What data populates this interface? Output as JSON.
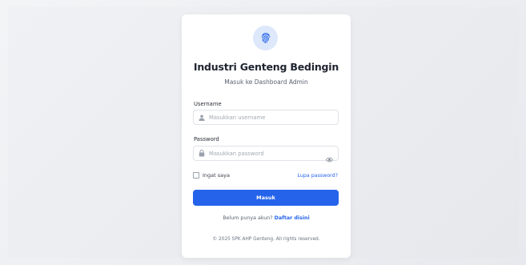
{
  "app": {
    "title": "Industri Genteng Bedingin",
    "subtitle": "Masuk ke Dashboard Admin"
  },
  "form": {
    "username_label": "Username",
    "username_placeholder": "Masukkan username",
    "username_value": "",
    "password_label": "Password",
    "password_placeholder": "Masukkan password",
    "password_value": "",
    "remember_label": "Ingat saya",
    "remember_checked": false,
    "forgot_link": "Lupa password?",
    "submit_label": "Masuk"
  },
  "register": {
    "prompt": "Belum punya akun?",
    "link": "Daftar disini"
  },
  "footer": {
    "text": "© 2025 SPK AHP Genteng. All rights reserved."
  },
  "colors": {
    "accent": "#2563eb",
    "logo_bg": "#dde8fb"
  },
  "icons": {
    "logo": "fingerprint-icon",
    "username": "user-icon",
    "password": "lock-icon",
    "toggle": "eye-icon"
  }
}
